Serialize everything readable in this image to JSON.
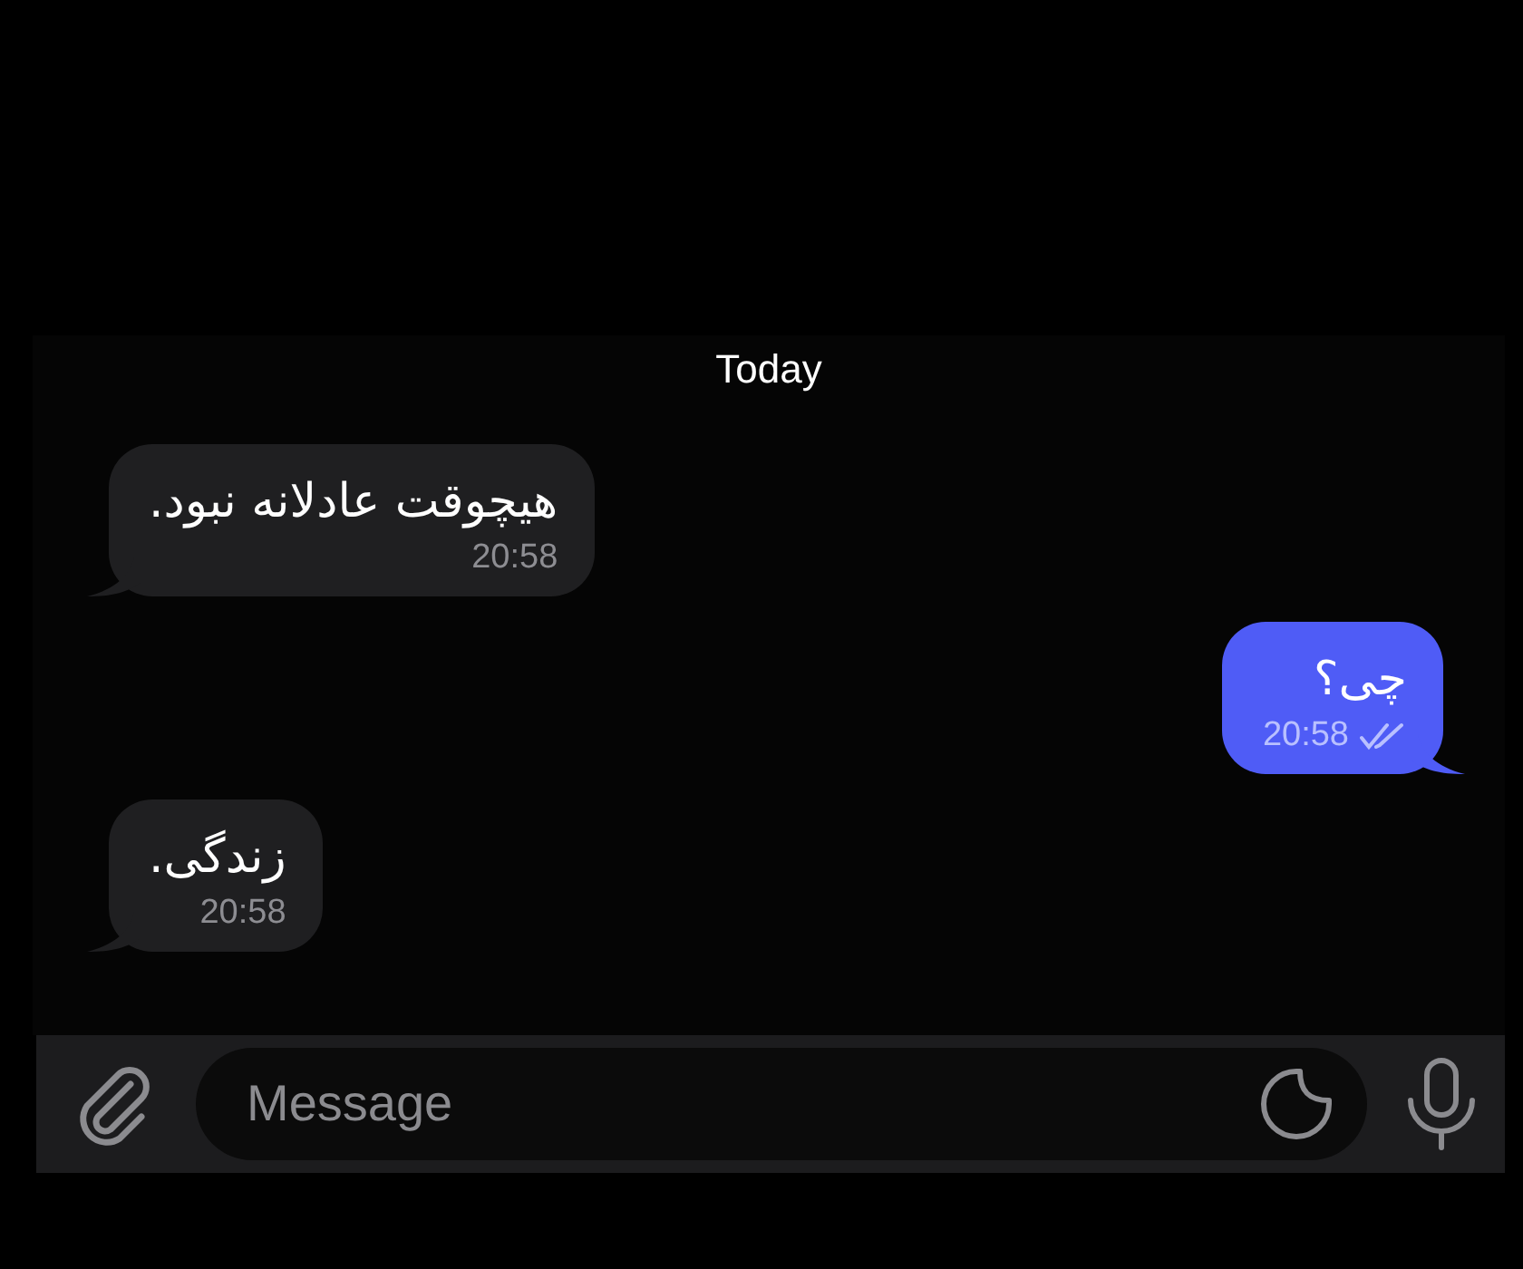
{
  "date_separator": "Today",
  "messages": [
    {
      "kind": "incoming",
      "text": "هیچوقت عادلانه نبود.",
      "time": "20:58"
    },
    {
      "kind": "outgoing",
      "text": "چی؟",
      "time": "20:58",
      "read": true
    },
    {
      "kind": "incoming",
      "text": "زندگی.",
      "time": "20:58"
    }
  ],
  "composer": {
    "placeholder": "Message"
  }
}
